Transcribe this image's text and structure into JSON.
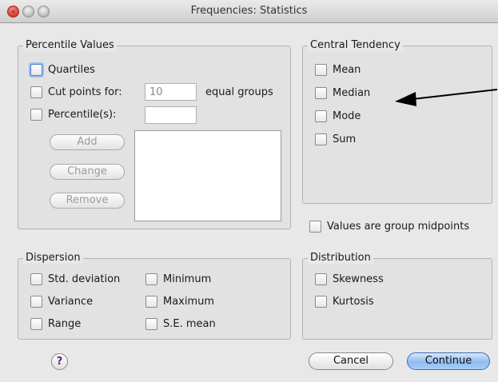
{
  "window": {
    "title": "Frequencies: Statistics"
  },
  "percentile_values": {
    "legend": "Percentile Values",
    "quartiles": "Quartiles",
    "cut_points": "Cut points for:",
    "cut_points_value": "10",
    "equal_groups": "equal groups",
    "percentiles": "Percentile(s):",
    "percentile_value": "",
    "add": "Add",
    "change": "Change",
    "remove": "Remove"
  },
  "central_tendency": {
    "legend": "Central Tendency",
    "items": [
      "Mean",
      "Median",
      "Mode",
      "Sum"
    ]
  },
  "group_midpoints": "Values are group midpoints",
  "dispersion": {
    "legend": "Dispersion",
    "items": [
      "Std. deviation",
      "Minimum",
      "Variance",
      "Maximum",
      "Range",
      "S.E. mean"
    ]
  },
  "distribution": {
    "legend": "Distribution",
    "items": [
      "Skewness",
      "Kurtosis"
    ]
  },
  "footer": {
    "help_symbol": "?",
    "cancel": "Cancel",
    "continue": "Continue"
  },
  "colors": {
    "default_button": "#8fbcf0",
    "annotation_arrow": "#000000"
  },
  "icons": [
    "close-light",
    "minimize-light",
    "zoom-light",
    "help-icon",
    "annotation-arrow"
  ]
}
